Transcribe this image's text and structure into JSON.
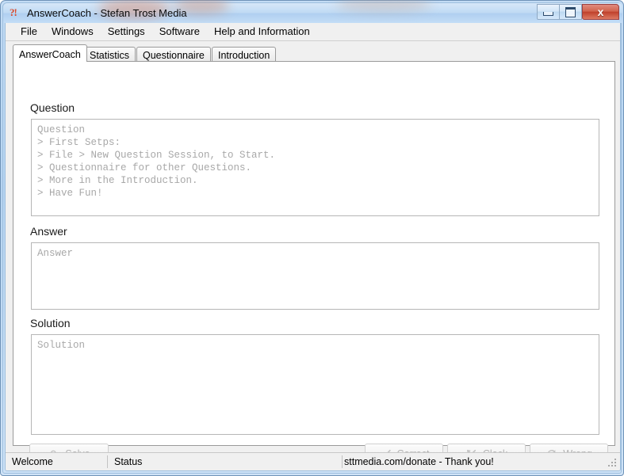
{
  "window": {
    "title": "AnswerCoach - Stefan Trost Media",
    "app_icon": "question-exclamation-icon",
    "controls": {
      "minimize": "–",
      "maximize": "□",
      "close": "x"
    }
  },
  "menubar": {
    "items": [
      {
        "label": "File"
      },
      {
        "label": "Windows"
      },
      {
        "label": "Settings"
      },
      {
        "label": "Software"
      },
      {
        "label": "Help and Information"
      }
    ]
  },
  "tabs": [
    {
      "label": "AnswerCoach",
      "active": true
    },
    {
      "label": "Statistics",
      "active": false
    },
    {
      "label": "Questionnaire",
      "active": false
    },
    {
      "label": "Introduction",
      "active": false
    }
  ],
  "sections": {
    "question": {
      "label": "Question",
      "placeholder": "Question\n> First Setps:\n> File > New Question Session, to Start.\n> Questionnaire for other Questions.\n> More in the Introduction.\n> Have Fun!"
    },
    "answer": {
      "label": "Answer",
      "placeholder": "Answer"
    },
    "solution": {
      "label": "Solution",
      "placeholder": "Solution"
    }
  },
  "buttons": {
    "solve": {
      "label": "Solve",
      "icon": "question-mark-icon",
      "disabled": true
    },
    "correct": {
      "label": "Correct",
      "icon": "check-icon",
      "disabled": true
    },
    "clock": {
      "label": "Clock",
      "icon": "cross-arrows-icon",
      "disabled": true
    },
    "wrong": {
      "label": "Wrong",
      "icon": "refresh-icon",
      "disabled": true
    }
  },
  "statusbar": {
    "welcome": "Welcome",
    "status": "Status",
    "donate": "sttmedia.com/donate - Thank you!"
  },
  "colors": {
    "titlebar": "#b6d4f1",
    "close_button": "#c0412c",
    "app_icon": "#d94a2b",
    "panel": "#f0f0f0",
    "placeholder_text": "#a8a8a8"
  }
}
